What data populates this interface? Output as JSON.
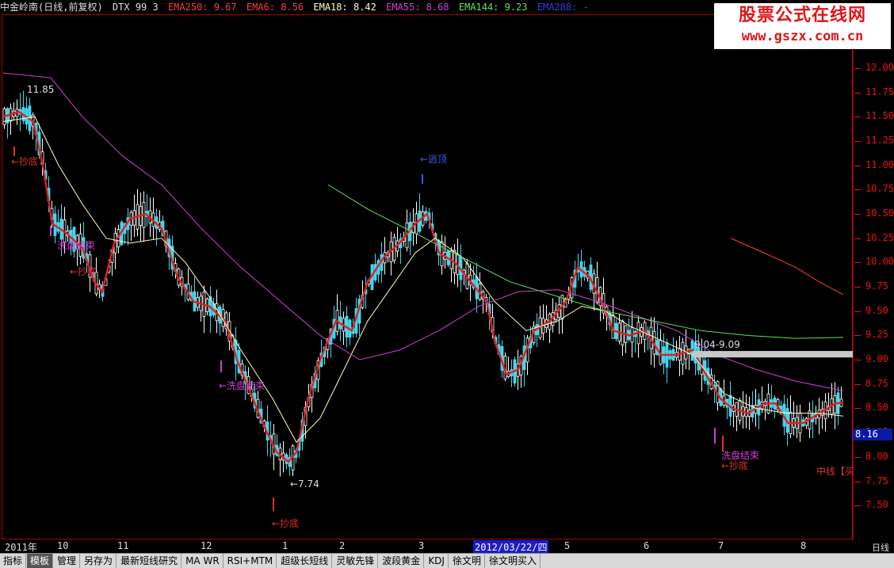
{
  "header": {
    "stock": "中金岭南(日线,前复权)",
    "indicator": "DTX 99 3",
    "ema250": "EMA250: 9.67",
    "ema6": "EMA6: 8.56",
    "ema18": "EMA18: 8.42",
    "ema55": "EMA55: 8.68",
    "ema144": "EMA144: 9.23",
    "ema288": "EMA288: -"
  },
  "colors": {
    "ema250": "#ff3b3b",
    "ema6": "#e02020",
    "ema18": "#ffffc0",
    "ema55": "#d040d0",
    "ema144": "#60e060",
    "ema288": "#3a3adf",
    "up": "#ffffff",
    "down": "#40d8f0",
    "axis": "#e01010"
  },
  "watermark": {
    "line1": "股票公式在线网",
    "line2": "www.gszx.com.cn"
  },
  "y_axis": {
    "ticks": [
      "12.00",
      "11.75",
      "11.50",
      "11.25",
      "11.00",
      "10.75",
      "10.50",
      "10.25",
      "10.00",
      "9.75",
      "9.50",
      "9.25",
      "9.00",
      "8.75",
      "8.50",
      "8.25",
      "8.00",
      "7.75",
      "7.50"
    ]
  },
  "last_price": "8.16",
  "x_axis": {
    "labels": [
      "2011年",
      "10",
      "11",
      "12",
      "1",
      "2",
      "3",
      "2012/03/22/四",
      "5",
      "6",
      "7",
      "8"
    ],
    "period": "日线"
  },
  "annotations": {
    "high": "11.85",
    "low": "←7.74",
    "range": "9.04-9.09",
    "a1": "←抄底",
    "a2": "洗盘结束",
    "a3": "←抄底",
    "a4": "←逃顶",
    "a5": "←洗盘结束",
    "a6": "←抄底",
    "a7": "洗盘结束",
    "a8": "←抄底",
    "a9": "中线【买"
  },
  "tabs": [
    "指标",
    "模板",
    "管理",
    "另存为",
    "最新短线研究",
    "MA WR",
    "RSI+MTM",
    "超级长短线",
    "灵敏先锋",
    "波段黄金",
    "KDJ",
    "徐文明",
    "徐文明买入"
  ],
  "chart_data": {
    "type": "candlestick",
    "title": "中金岭南(日线,前复权)",
    "ylim": [
      7.3,
      12.15
    ],
    "x": [
      "2011-09",
      "2011-10",
      "2011-11",
      "2011-12",
      "2012-01",
      "2012-02",
      "2012-03",
      "2012-04",
      "2012-05",
      "2012-06",
      "2012-07",
      "2012-08"
    ],
    "close_path": [
      [
        0,
        11.5
      ],
      [
        20,
        11.55
      ],
      [
        38,
        11.45
      ],
      [
        50,
        11.0
      ],
      [
        62,
        10.4
      ],
      [
        80,
        10.3
      ],
      [
        100,
        10.15
      ],
      [
        115,
        9.8
      ],
      [
        125,
        9.7
      ],
      [
        140,
        10.2
      ],
      [
        160,
        10.45
      ],
      [
        180,
        10.5
      ],
      [
        200,
        10.35
      ],
      [
        220,
        9.85
      ],
      [
        240,
        9.6
      ],
      [
        260,
        9.55
      ],
      [
        280,
        9.4
      ],
      [
        295,
        9.0
      ],
      [
        310,
        8.7
      ],
      [
        330,
        8.3
      ],
      [
        345,
        8.05
      ],
      [
        360,
        7.95
      ],
      [
        370,
        8.05
      ],
      [
        385,
        8.6
      ],
      [
        400,
        9.0
      ],
      [
        420,
        9.4
      ],
      [
        440,
        9.3
      ],
      [
        460,
        9.8
      ],
      [
        480,
        10.05
      ],
      [
        500,
        10.2
      ],
      [
        520,
        10.4
      ],
      [
        535,
        10.5
      ],
      [
        550,
        10.1
      ],
      [
        570,
        10.0
      ],
      [
        590,
        9.8
      ],
      [
        610,
        9.6
      ],
      [
        620,
        9.2
      ],
      [
        635,
        8.85
      ],
      [
        650,
        8.9
      ],
      [
        670,
        9.3
      ],
      [
        690,
        9.4
      ],
      [
        710,
        9.6
      ],
      [
        725,
        9.95
      ],
      [
        740,
        9.85
      ],
      [
        755,
        9.6
      ],
      [
        770,
        9.3
      ],
      [
        790,
        9.25
      ],
      [
        810,
        9.3
      ],
      [
        830,
        9.05
      ],
      [
        850,
        9.05
      ],
      [
        870,
        9.1
      ],
      [
        890,
        8.8
      ],
      [
        905,
        8.6
      ],
      [
        920,
        8.5
      ],
      [
        940,
        8.45
      ],
      [
        960,
        8.55
      ],
      [
        975,
        8.55
      ],
      [
        990,
        8.35
      ],
      [
        1010,
        8.35
      ],
      [
        1030,
        8.45
      ],
      [
        1050,
        8.55
      ],
      [
        1060,
        8.56
      ]
    ],
    "series": [
      {
        "name": "EMA6",
        "values_path": "close_path"
      },
      {
        "name": "EMA18",
        "points": [
          [
            0,
            11.45
          ],
          [
            40,
            11.5
          ],
          [
            70,
            11.0
          ],
          [
            100,
            10.6
          ],
          [
            130,
            10.25
          ],
          [
            160,
            10.2
          ],
          [
            200,
            10.25
          ],
          [
            230,
            10.0
          ],
          [
            260,
            9.65
          ],
          [
            300,
            9.1
          ],
          [
            340,
            8.6
          ],
          [
            370,
            8.15
          ],
          [
            400,
            8.4
          ],
          [
            430,
            8.9
          ],
          [
            460,
            9.4
          ],
          [
            490,
            9.75
          ],
          [
            520,
            10.1
          ],
          [
            545,
            10.25
          ],
          [
            580,
            10.05
          ],
          [
            620,
            9.6
          ],
          [
            660,
            9.3
          ],
          [
            700,
            9.4
          ],
          [
            730,
            9.55
          ],
          [
            760,
            9.5
          ],
          [
            790,
            9.35
          ],
          [
            830,
            9.2
          ],
          [
            870,
            9.05
          ],
          [
            910,
            8.65
          ],
          [
            950,
            8.5
          ],
          [
            990,
            8.45
          ],
          [
            1030,
            8.45
          ],
          [
            1060,
            8.42
          ]
        ]
      },
      {
        "name": "EMA55",
        "points": [
          [
            0,
            11.95
          ],
          [
            60,
            11.9
          ],
          [
            100,
            11.5
          ],
          [
            150,
            11.1
          ],
          [
            200,
            10.8
          ],
          [
            250,
            10.35
          ],
          [
            300,
            9.95
          ],
          [
            350,
            9.6
          ],
          [
            400,
            9.25
          ],
          [
            450,
            9.0
          ],
          [
            500,
            9.1
          ],
          [
            550,
            9.3
          ],
          [
            600,
            9.55
          ],
          [
            650,
            9.7
          ],
          [
            700,
            9.72
          ],
          [
            750,
            9.6
          ],
          [
            800,
            9.45
          ],
          [
            850,
            9.3
          ],
          [
            900,
            9.05
          ],
          [
            950,
            8.9
          ],
          [
            1000,
            8.78
          ],
          [
            1060,
            8.68
          ]
        ]
      },
      {
        "name": "EMA144",
        "points": [
          [
            410,
            10.8
          ],
          [
            460,
            10.55
          ],
          [
            520,
            10.3
          ],
          [
            580,
            10.05
          ],
          [
            640,
            9.8
          ],
          [
            700,
            9.65
          ],
          [
            760,
            9.5
          ],
          [
            820,
            9.4
          ],
          [
            880,
            9.3
          ],
          [
            940,
            9.25
          ],
          [
            1000,
            9.22
          ],
          [
            1060,
            9.23
          ]
        ]
      },
      {
        "name": "EMA250",
        "points": [
          [
            918,
            10.25
          ],
          [
            960,
            10.1
          ],
          [
            1000,
            9.95
          ],
          [
            1030,
            9.8
          ],
          [
            1060,
            9.67
          ]
        ]
      }
    ]
  }
}
